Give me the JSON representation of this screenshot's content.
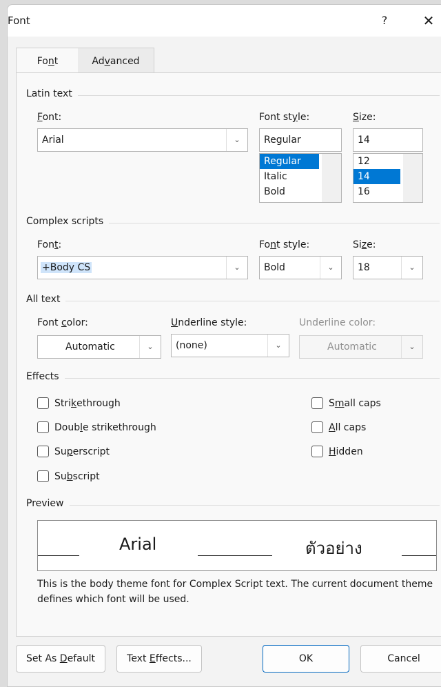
{
  "dialog": {
    "title": "Font",
    "help_glyph": "?",
    "close_glyph": "✕"
  },
  "tabs": [
    {
      "label_parts": [
        "Fo",
        "n",
        "t"
      ]
    },
    {
      "label_parts": [
        "Ad",
        "v",
        "anced"
      ]
    }
  ],
  "latin": {
    "group_label": "Latin text",
    "font_label_parts": [
      "",
      "F",
      "ont:"
    ],
    "font_value": "Arial",
    "style_label_parts": [
      "Font st",
      "y",
      "le:"
    ],
    "style_value": "Regular",
    "style_options": [
      "Regular",
      "Italic",
      "Bold"
    ],
    "style_selected": 0,
    "size_label_parts": [
      "",
      "S",
      "ize:"
    ],
    "size_value": "14",
    "size_options": [
      "12",
      "14",
      "16"
    ],
    "size_selected": 1
  },
  "complex": {
    "group_label": "Complex scripts",
    "font_label_parts": [
      "Fon",
      "t",
      ":"
    ],
    "font_value": "+Body CS",
    "style_label_parts": [
      "Fo",
      "n",
      "t style:"
    ],
    "style_value": "Bold",
    "size_label_parts": [
      "Si",
      "z",
      "e:"
    ],
    "size_value": "18"
  },
  "all_text": {
    "group_label": "All text",
    "color_label_parts": [
      "Font ",
      "c",
      "olor:"
    ],
    "color_value": "Automatic",
    "underline_label_parts": [
      "",
      "U",
      "nderline style:"
    ],
    "underline_value": "(none)",
    "underline_color_label": "Underline color:",
    "underline_color_value": "Automatic"
  },
  "effects": {
    "group_label": "Effects",
    "left": [
      {
        "parts": [
          "Stri",
          "k",
          "ethrough"
        ]
      },
      {
        "parts": [
          "Doub",
          "l",
          "e strikethrough"
        ]
      },
      {
        "parts": [
          "Su",
          "p",
          "erscript"
        ]
      },
      {
        "parts": [
          "Su",
          "b",
          "script"
        ]
      }
    ],
    "right": [
      {
        "parts": [
          "S",
          "m",
          "all caps"
        ]
      },
      {
        "parts": [
          "",
          "A",
          "ll caps"
        ]
      },
      {
        "parts": [
          "",
          "H",
          "idden"
        ]
      }
    ]
  },
  "preview": {
    "group_label": "Preview",
    "latin_sample": "Arial",
    "complex_sample": "ตัวอย่าง",
    "description": "This is the body theme font for Complex Script text. The current document theme defines which font will be used."
  },
  "buttons": {
    "set_default_parts": [
      "Set As ",
      "D",
      "efault"
    ],
    "text_effects_parts": [
      "Text ",
      "E",
      "ffects..."
    ],
    "ok": "OK",
    "cancel": "Cancel"
  },
  "colors": {
    "accent": "#0078d4",
    "selection_highlight": "#cfe4fa"
  }
}
